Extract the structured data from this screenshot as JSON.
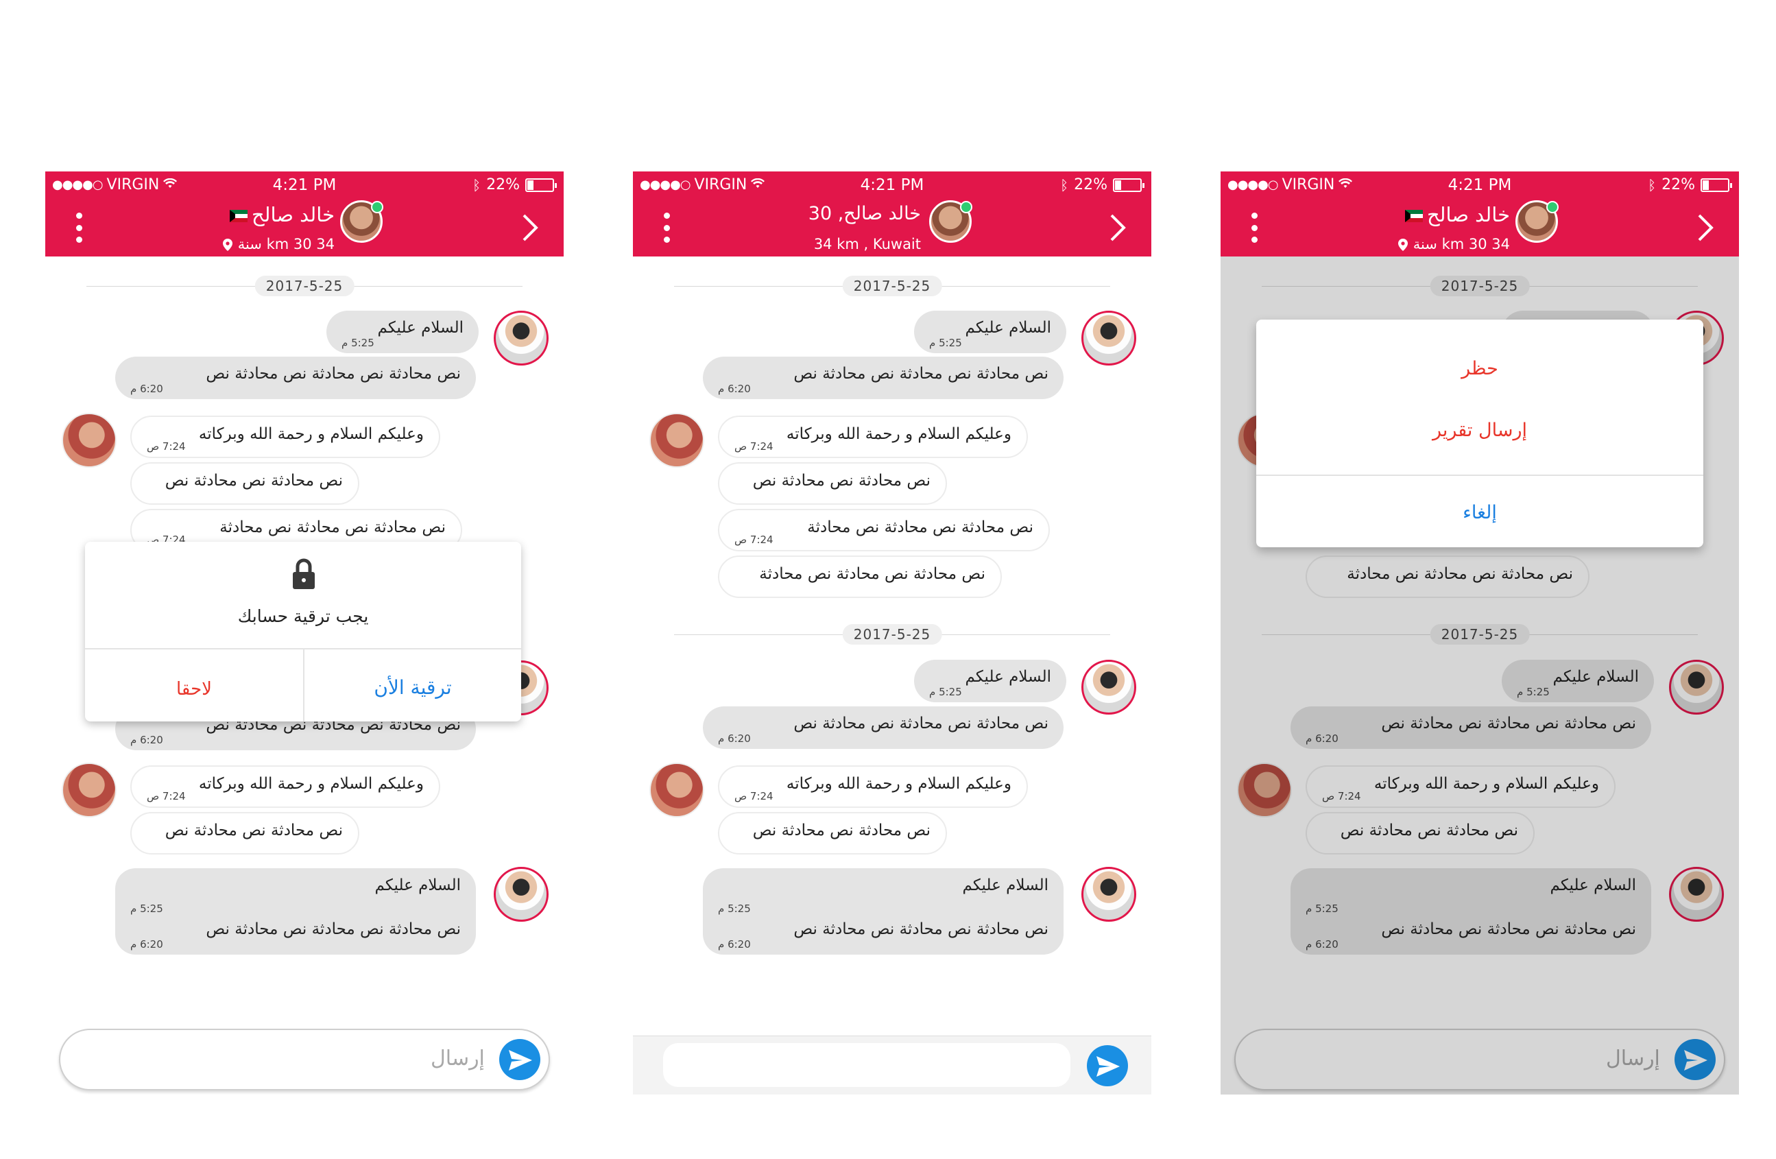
{
  "status": {
    "carrier": "VIRGIN",
    "time": "4:21 PM",
    "battery": "22%",
    "battery_level": 0.22
  },
  "contact": {
    "name": "خالد صالح",
    "name_age": "خالد صالح, 30",
    "distance_age": "34 km 30 سنة",
    "distance_country": "34 km ,  Kuwait"
  },
  "dates": {
    "d1": "2017-5-25",
    "d2": "2017-5-25"
  },
  "messages": {
    "salam": "السلام عليكم",
    "t525": "5:25 م",
    "long": "نص محادثة نص محادثة نص محادثة نص",
    "t620": "6:20 م",
    "reply": "وعليكم السلام و رحمة الله وبركاته",
    "t724": "7:24 ص",
    "short": "نص محادثة نص محادثة نص",
    "medium": "نص محادثة نص محادثة نص محادثة",
    "medium2": "نص محادثة نص محادثة نص محادثة"
  },
  "input": {
    "placeholder": "إرسال"
  },
  "upgrade_dialog": {
    "message": "يجب ترقية حسابك",
    "later": "لاحقا",
    "upgrade": "ترقية الأن"
  },
  "action_sheet": {
    "block": "حظر",
    "report": "إرسال تقرير",
    "cancel": "إلغاء"
  },
  "colors": {
    "header": "#e2164a",
    "accent_blue": "#1a8fe3",
    "danger": "#e8352a",
    "online": "#2ecc71"
  }
}
